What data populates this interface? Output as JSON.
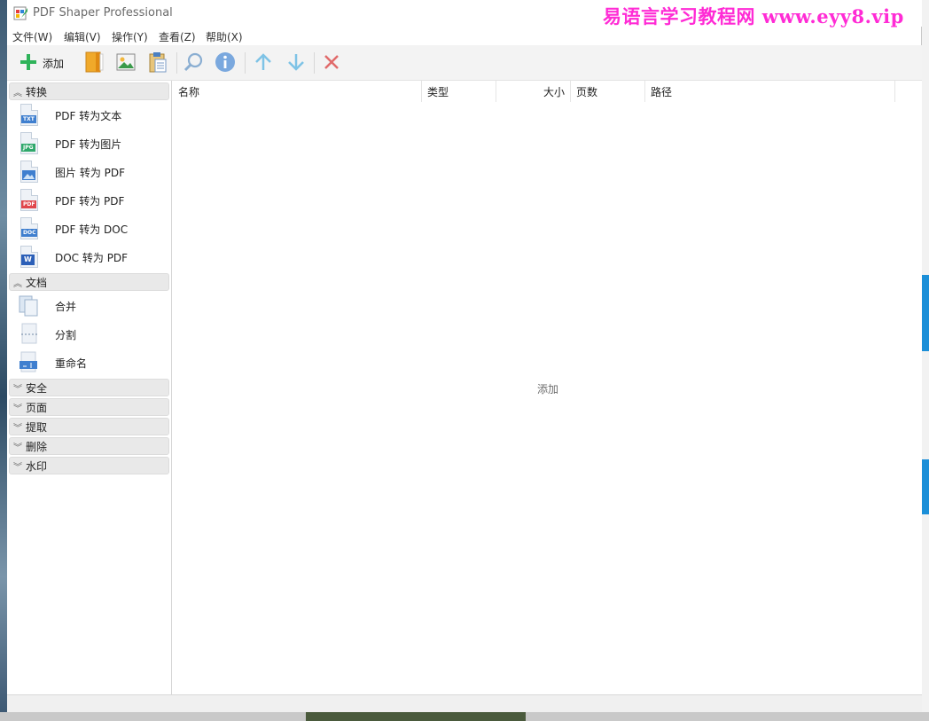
{
  "window": {
    "title": "PDF Shaper Professional",
    "watermark": "易语言学习教程网 www.eyy8.vip"
  },
  "menu": {
    "items": [
      "文件(W)",
      "编辑(V)",
      "操作(Y)",
      "查看(Z)",
      "帮助(X)"
    ]
  },
  "toolbar": {
    "add_label": "添加",
    "icons": [
      "plus-icon",
      "book-icon",
      "image-icon",
      "clipboard-icon",
      "search-icon",
      "info-icon",
      "arrow-up-icon",
      "arrow-down-icon",
      "close-icon"
    ]
  },
  "sidebar": {
    "convert": {
      "header": "转换",
      "items": [
        {
          "label": "PDF 转为文本",
          "tag": "TXT",
          "color": "#3f7fcf"
        },
        {
          "label": "PDF 转为图片",
          "tag": "JPG",
          "color": "#2fa86b"
        },
        {
          "label": "图片 转为 PDF",
          "tag": "IMG",
          "color": "#3f7fcf"
        },
        {
          "label": "PDF 转为 PDF",
          "tag": "PDF",
          "color": "#e0474c"
        },
        {
          "label": "PDF 转为 DOC",
          "tag": "DOC",
          "color": "#3f7fcf"
        },
        {
          "label": "DOC 转为 PDF",
          "tag": "W",
          "color": "#2b5fb8"
        }
      ]
    },
    "document": {
      "header": "文档",
      "items": [
        {
          "label": "合并"
        },
        {
          "label": "分割"
        },
        {
          "label": "重命名"
        }
      ]
    },
    "collapsed": [
      "安全",
      "页面",
      "提取",
      "删除",
      "水印"
    ]
  },
  "filelist": {
    "columns": [
      "名称",
      "类型",
      "大小",
      "页数",
      "路径"
    ],
    "empty_hint": "添加"
  },
  "colors": {
    "accent_green": "#2fb35a",
    "arrow_blue": "#7ec3e6",
    "close_red": "#e06a6a",
    "watermark": "#ff2bd5"
  }
}
